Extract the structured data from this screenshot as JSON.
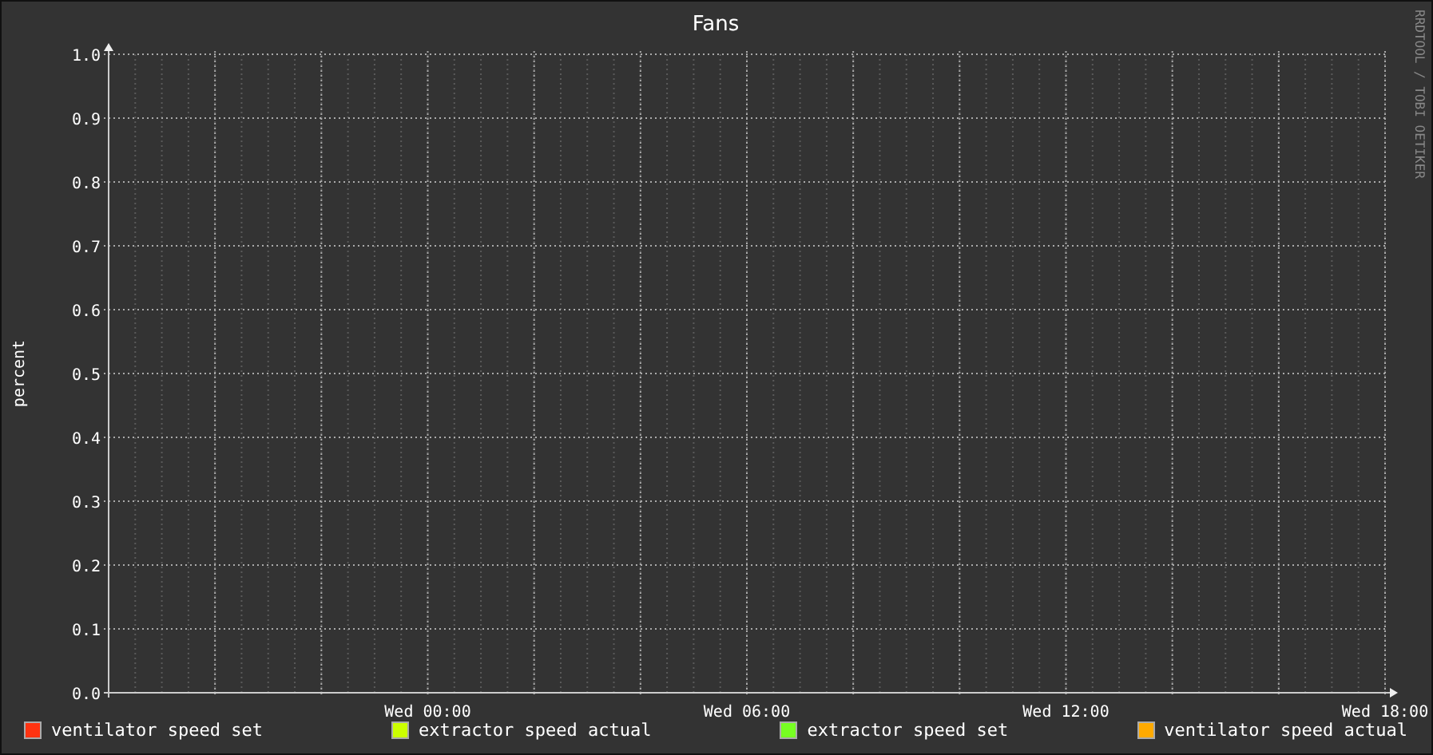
{
  "title": "Fans",
  "watermark": "RRDTOOL / TOBI OETIKER",
  "chart_data": {
    "type": "line",
    "grid": true,
    "ylabel": "percent",
    "ylim": [
      0,
      1
    ],
    "categories": [
      null,
      "Wed 00:00",
      "Wed 06:00",
      "Wed 12:00",
      "Wed 18:00"
    ],
    "yticks": [
      {
        "value": 0,
        "label": "0.0"
      },
      {
        "value": 0.1,
        "label": "0.1"
      },
      {
        "value": 0.2,
        "label": "0.2"
      },
      {
        "value": 0.3,
        "label": "0.3"
      },
      {
        "value": 0.4,
        "label": "0.4"
      },
      {
        "value": 0.5,
        "label": "0.5"
      },
      {
        "value": 0.6,
        "label": "0.6"
      },
      {
        "value": 0.7,
        "label": "0.7"
      },
      {
        "value": 0.8,
        "label": "0.8"
      },
      {
        "value": 0.9,
        "label": "0.9"
      },
      {
        "value": 1,
        "label": "1.0"
      }
    ],
    "series": [
      {
        "name": "ventilator speed set",
        "color": "#ff3311",
        "values": [
          null,
          null,
          null,
          null,
          null
        ]
      },
      {
        "name": "extractor speed actual",
        "color": "#ccff00",
        "values": [
          null,
          null,
          null,
          null,
          null
        ]
      },
      {
        "name": "extractor speed set",
        "color": "#77ff22",
        "values": [
          null,
          null,
          null,
          null,
          null
        ]
      },
      {
        "name": "ventilator speed actual",
        "color": "#ffaa00",
        "values": [
          null,
          null,
          null,
          null,
          null
        ]
      }
    ]
  }
}
